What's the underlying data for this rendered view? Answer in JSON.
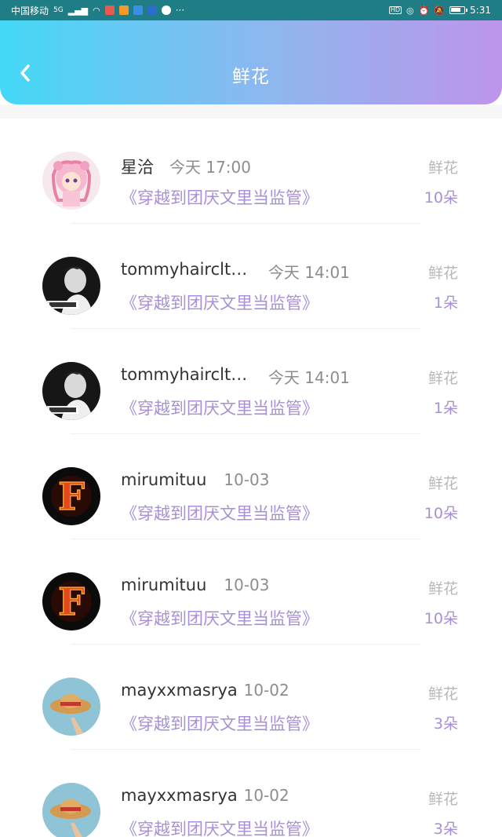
{
  "status_bar": {
    "carrier": "中国移动",
    "network": "5G",
    "more": "···",
    "time": "5:31",
    "right_icons": [
      "hd-icon",
      "signal-eye-icon",
      "alarm-icon",
      "mute-icon",
      "battery-icon"
    ]
  },
  "header": {
    "back_icon": "chevron-left-icon",
    "title": "鲜花"
  },
  "colors": {
    "gradient_start": "#44d8f6",
    "gradient_end": "#bd95ea",
    "accent_purple": "#a88fd6"
  },
  "records": [
    {
      "user": "星洽",
      "time": "今天 17:00",
      "book": "《穿越到团厌文里当监管》",
      "type": "鲜花",
      "count": "10朵",
      "avatar": "anime-girl-avatar"
    },
    {
      "user": "tommyhairclt…",
      "time": "今天 14:01",
      "book": "《穿越到团厌文里当监管》",
      "type": "鲜花",
      "count": "1朵",
      "avatar": "bw-portrait-avatar"
    },
    {
      "user": "tommyhairclt…",
      "time": "今天 14:01",
      "book": "《穿越到团厌文里当监管》",
      "type": "鲜花",
      "count": "1朵",
      "avatar": "bw-portrait-avatar"
    },
    {
      "user": "mirumituu",
      "time": "10-03",
      "book": "《穿越到团厌文里当监管》",
      "type": "鲜花",
      "count": "10朵",
      "avatar": "fire-letter-avatar"
    },
    {
      "user": "mirumituu",
      "time": "10-03",
      "book": "《穿越到团厌文里当监管》",
      "type": "鲜花",
      "count": "10朵",
      "avatar": "fire-letter-avatar"
    },
    {
      "user": "mayxxmasrya",
      "time": "10-02",
      "book": "《穿越到团厌文里当监管》",
      "type": "鲜花",
      "count": "3朵",
      "avatar": "straw-hat-avatar"
    },
    {
      "user": "mayxxmasrya",
      "time": "10-02",
      "book": "《穿越到团厌文里当监管》",
      "type": "鲜花",
      "count": "3朵",
      "avatar": "straw-hat-avatar"
    }
  ]
}
